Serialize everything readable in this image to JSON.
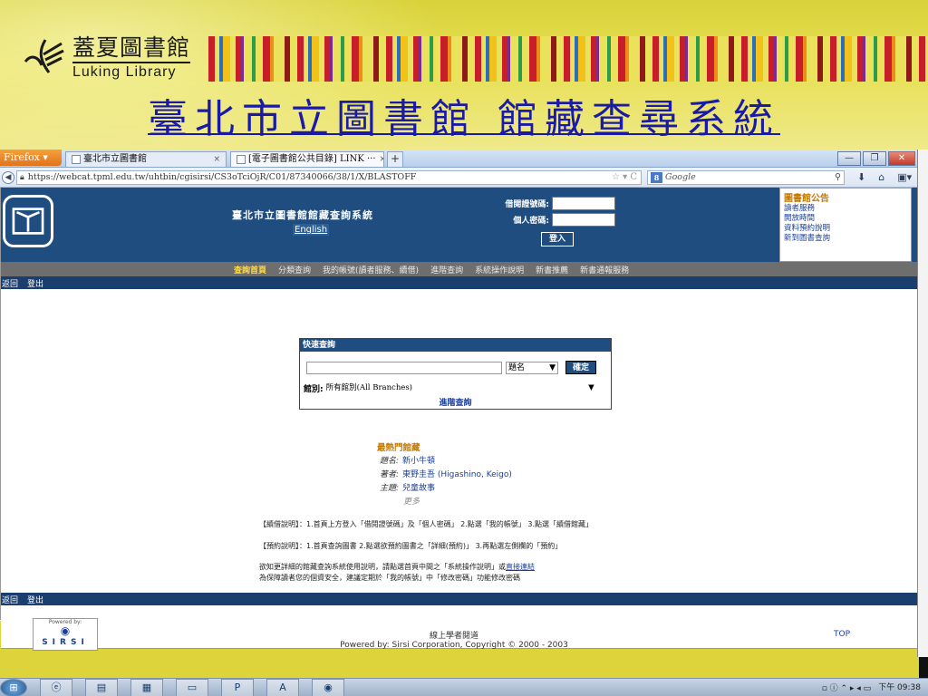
{
  "slide": {
    "logo_cn": "蓋夏圖書館",
    "logo_en": "Luking Library",
    "title": "臺北市立圖書館 館藏查尋系統"
  },
  "browser": {
    "app_button": "Firefox",
    "tabs": [
      {
        "label": "臺北市立圖書館"
      },
      {
        "label": "[電子圖書館公共目錄] LINK ···"
      }
    ],
    "url": "https://webcat.tpml.edu.tw/uhtbin/cgisirsi/CS3oTciOjR/C01/87340066/38/1/X/BLASTOFF",
    "search_placeholder": "Google"
  },
  "site": {
    "title": "臺北市立圖書館館藏查詢系統",
    "english_link": "English",
    "login": {
      "card_label": "借閱證號碼:",
      "password_label": "個人密碼:",
      "submit": "登入"
    },
    "notice": {
      "title": "圖書館公告",
      "links": [
        "讀者服務",
        "開放時間",
        "資料預約說明",
        "新到圖書查詢"
      ]
    },
    "menu": [
      "查詢首頁",
      "分類查詢",
      "我的帳號(讀者服務、續借)",
      "進階查詢",
      "系統操作說明",
      "新書推薦",
      "新書通報服務"
    ],
    "subnav": [
      "返回",
      "登出"
    ]
  },
  "quick_search": {
    "title": "快速查詢",
    "field_type": "題名",
    "submit": "確定",
    "branch_label": "館別:",
    "branch_value": "所有館別(All Branches)",
    "advanced": "進階查詢"
  },
  "popular": {
    "title": "最熱門館藏",
    "items": [
      {
        "key": "題名:",
        "value": "新小牛頓"
      },
      {
        "key": "著者:",
        "value": "東野圭吾 (Higashino, Keigo)"
      },
      {
        "key": "主題:",
        "value": "兒童故事"
      }
    ],
    "more": "更多"
  },
  "help": {
    "renew": "【續借說明】：1.首頁上方登入「借閱證號碼」及「個人密碼」 2.點選「我的帳號」 3.點選「續借館藏」",
    "reserve": "【預約說明】：1.首頁查詢圖書 2.點選欲預約圖書之「詳細(預約)」 3.再點選左側欄的「預約」",
    "detail_prefix": "欲知更詳細的館藏查詢系統使用說明，請點選首頁中間之「系統操作說明」或",
    "detail_link": "直接連結",
    "security": "為保障讀者您的個資安全，建議定期於「我的帳號」中「修改密碼」功能修改密碼"
  },
  "footer": {
    "powered_box": "Powered by:",
    "sirsi": "SIRSI",
    "online_learning": "線上學者閱道",
    "copyright": "Powered by: Sirsi Corporation, Copyright © 2000 - 2003",
    "top": "TOP"
  },
  "taskbar": {
    "clock_line1": "下午 09:38"
  }
}
